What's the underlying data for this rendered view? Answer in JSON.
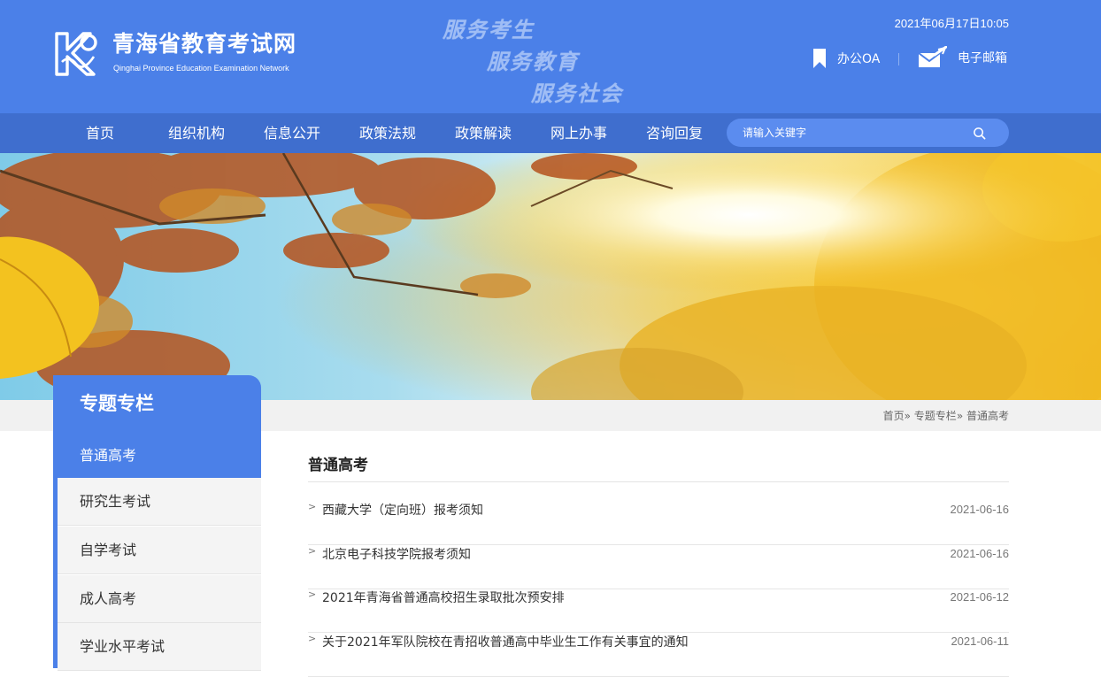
{
  "header": {
    "site_title": "青海省教育考试网",
    "site_subtitle": "Qinghai Province Education Examination Network",
    "slogans": [
      "服务考生",
      "服务教育",
      "服务社会"
    ],
    "datetime": "2021年06月17日10:05",
    "oa_label": "办公OA",
    "mail_label": "电子邮箱",
    "brand_color": "#4b80e8",
    "nav_color": "#3f6ece"
  },
  "nav": {
    "items": [
      "首页",
      "组织机构",
      "信息公开",
      "政策法规",
      "政策解读",
      "网上办事",
      "咨询回复"
    ],
    "search_placeholder": "请输入关键字"
  },
  "breadcrumb": {
    "home": "首页",
    "sep": "»",
    "section": "专题专栏",
    "current": "普通高考"
  },
  "sidebar": {
    "heading": "专题专栏",
    "items": [
      "普通高考",
      "研究生考试",
      "自学考试",
      "成人高考",
      "学业水平考试"
    ],
    "active_index": 0
  },
  "content": {
    "title": "普通高考",
    "bullet": ">",
    "news": [
      {
        "title": "西藏大学（定向班）报考须知",
        "date": "2021-06-16"
      },
      {
        "title": "北京电子科技学院报考须知",
        "date": "2021-06-16"
      },
      {
        "title": "2021年青海省普通高校招生录取批次预安排",
        "date": "2021-06-12"
      },
      {
        "title": "关于2021年军队院校在青招收普通高中毕业生工作有关事宜的通知",
        "date": "2021-06-11"
      }
    ]
  }
}
